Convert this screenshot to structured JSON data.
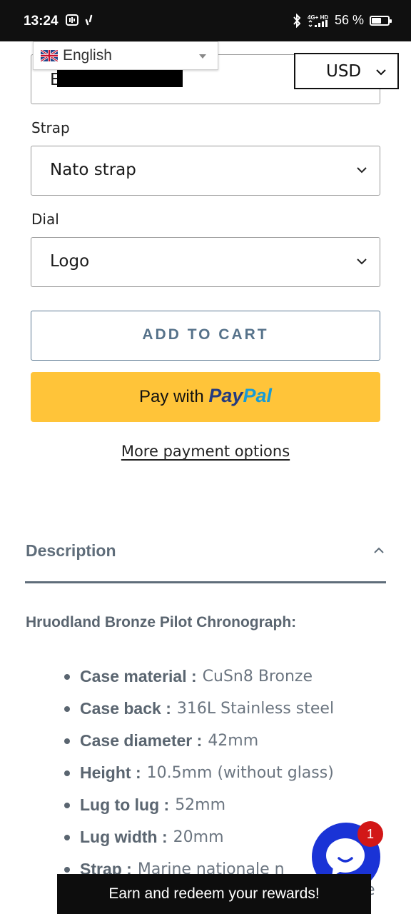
{
  "status_bar": {
    "time": "13:24",
    "network": "4G+ HD",
    "battery_text": "56 %",
    "battery_level": 0.56,
    "icons": [
      "sound-bars-icon",
      "signal-boost-icon",
      "bluetooth-icon",
      "mobile-signal-icon",
      "battery-icon"
    ]
  },
  "language": {
    "label": "English",
    "flag_icon": "uk-flag-icon"
  },
  "currency": {
    "label": "USD"
  },
  "top_field": {
    "value": "E"
  },
  "strap": {
    "label": "Strap",
    "value": "Nato strap"
  },
  "dial": {
    "label": "Dial",
    "value": "Logo"
  },
  "actions": {
    "add_to_cart": "ADD TO CART",
    "paypal_prefix": "Pay with",
    "paypal_brand_a": "Pay",
    "paypal_brand_b": "Pal",
    "more_payment": "More payment options"
  },
  "description": {
    "heading": "Description",
    "title": "Hruodland Bronze Pilot Chronograph:",
    "specs": [
      {
        "key": "Case material :",
        "value": "CuSn8 Bronze"
      },
      {
        "key": "Case back :",
        "value": "316L Stainless steel"
      },
      {
        "key": "Case diameter :",
        "value": "42mm"
      },
      {
        "key": "Height :",
        "value": "10.5mm (without glass)"
      },
      {
        "key": "Lug to lug :",
        "value": "52mm"
      },
      {
        "key": "Lug width :",
        "value": "20mm"
      },
      {
        "key": "Strap :",
        "value": "Marine nationale n"
      }
    ],
    "trailing_fragment": "e"
  },
  "chat": {
    "badge_count": "1"
  },
  "rewards": {
    "label": "Earn and redeem your rewards!"
  },
  "colors": {
    "accent": "#56728a",
    "paypal_yellow": "#ffc439",
    "paypal_dark_blue": "#253b80",
    "paypal_light_blue": "#179bd7",
    "chat_blue": "#1a33d6",
    "badge_red": "#d21717"
  }
}
